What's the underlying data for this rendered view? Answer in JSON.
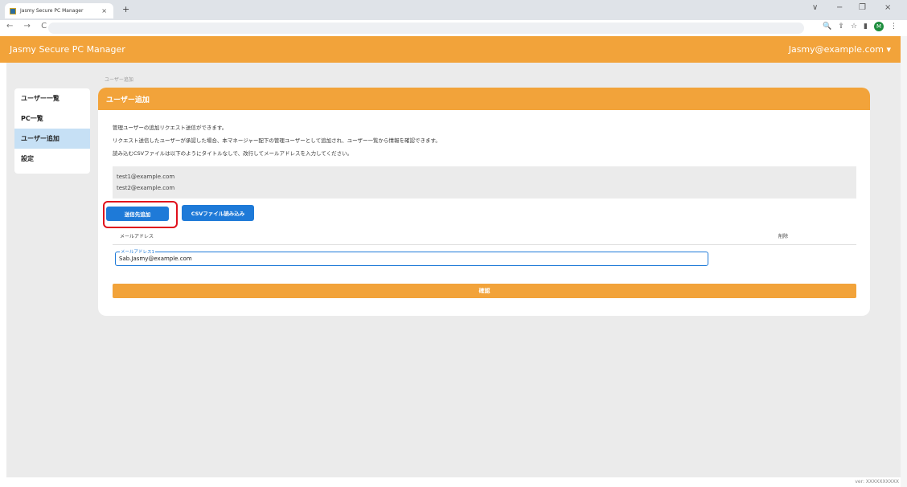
{
  "browser": {
    "tab_title": "Jasmy Secure PC Manager",
    "tab_close": "×",
    "new_tab": "+",
    "window_controls": [
      "∨",
      "−",
      "❐",
      "×"
    ],
    "nav": "← → C",
    "avatar_letter": "M"
  },
  "app": {
    "brand": "Jasmy Secure PC Manager",
    "user_menu": "Jasmy@example.com ▾"
  },
  "sidebar": {
    "items": [
      {
        "label": "ユーザー一覧"
      },
      {
        "label": "PC一覧"
      },
      {
        "label": "ユーザー追加"
      },
      {
        "label": "設定"
      }
    ]
  },
  "breadcrumb": "ユーザー追加",
  "card": {
    "title": "ユーザー追加",
    "desc1": "管理ユーザーの追加リクエスト送信ができます。",
    "desc2": "リクエスト送信したユーザーが承認した場合、本マネージャー配下の管理ユーザーとして追加され、ユーザー一覧から情報を確認できます。",
    "desc3": "読み込むCSVファイルは以下のようにタイトルなしで、改行してメールアドレスを入力してください。",
    "example_lines": [
      "test1@example.com",
      "test2@example.com"
    ],
    "add_button": "送信先追加",
    "csv_button": "CSVファイル読み込み",
    "col_email": "メールアドレス",
    "col_delete": "削除",
    "field_label": "メールアドレス1",
    "field_value": "Sab.Jasmy@example.com",
    "confirm_button": "確認"
  },
  "footer": {
    "version": "ver: XXXXXXXXXX"
  },
  "colors": {
    "accent": "#f2a33a",
    "primary": "#1e7ad8",
    "highlight": "#e0101c"
  }
}
